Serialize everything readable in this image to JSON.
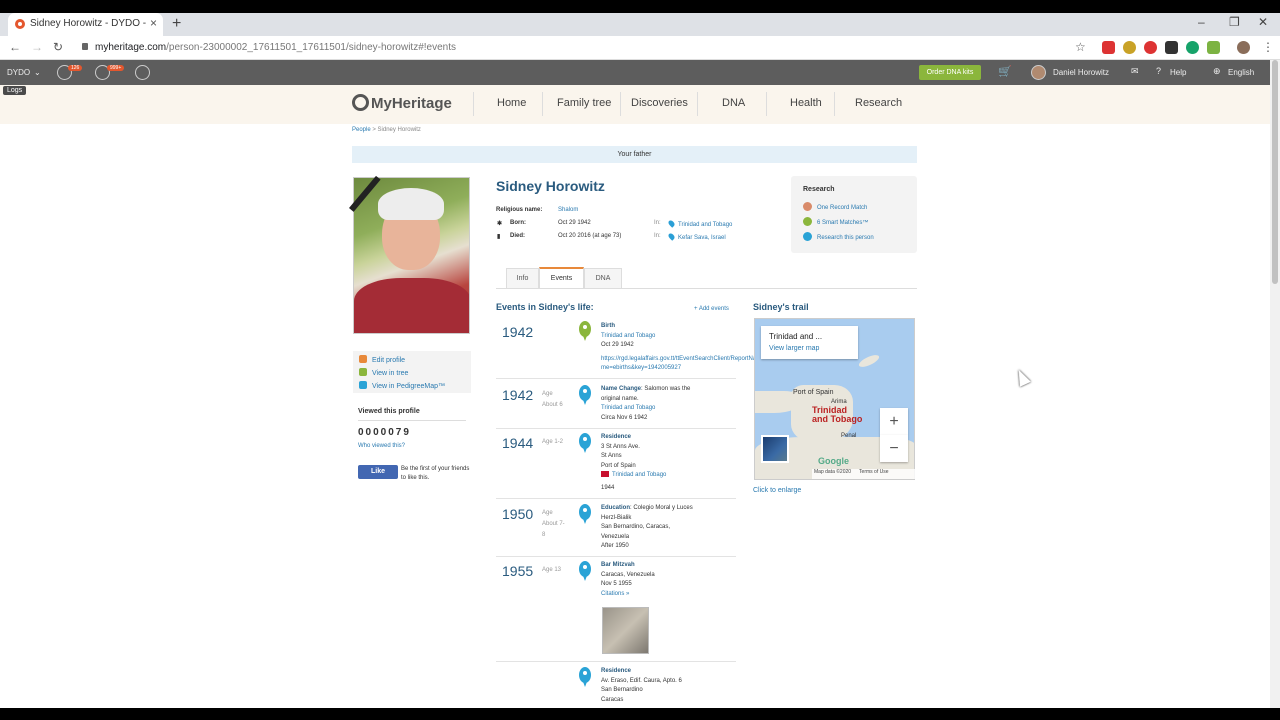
{
  "browser": {
    "tab_title": "Sidney Horowitz - DYDO - MyHeritage",
    "url_main": "myheritage.com",
    "url_rest": "/person-23000002_17611501_17611501/sidney-horowitz#!events"
  },
  "mhbar": {
    "site_name": "DYDO",
    "badge1": "126",
    "badge2": "999+",
    "order_label": "Order DNA kits",
    "user_name": "Daniel Horowitz",
    "help": "Help",
    "language": "English",
    "logs": "Logs"
  },
  "nav": {
    "logo": "MyHeritage",
    "items": [
      "Home",
      "Family tree",
      "Discoveries",
      "DNA",
      "Health",
      "Research"
    ]
  },
  "breadcrumb": {
    "people": "People",
    "sep": ">",
    "current": "Sidney Horowitz"
  },
  "relation": "Your father",
  "person": {
    "name": "Sidney Horowitz",
    "religious_label": "Religious name:",
    "religious_value": "Shalom",
    "born_label": "Born:",
    "born_date": "Oct 29 1942",
    "born_in": "In:",
    "born_place": "Trinidad and Tobago",
    "died_label": "Died:",
    "died_date": "Oct 20 2016 (at age 73)",
    "died_in": "In:",
    "died_place": "Kefar Sava, Israel"
  },
  "research": {
    "title": "Research",
    "items": [
      "One Record Match",
      "6 Smart Matches™",
      "Research this person"
    ]
  },
  "side": {
    "actions": [
      "Edit profile",
      "View in tree",
      "View in PedigreeMap™"
    ],
    "viewed_title": "Viewed this profile",
    "counter": "0000079",
    "who_viewed": "Who viewed this?",
    "like": "Like",
    "like_text": "Be the first of your friends to like this."
  },
  "tabs": [
    "Info",
    "Events",
    "DNA"
  ],
  "events_title": "Events in Sidney's life:",
  "add_events": "+ Add events",
  "events": [
    {
      "year": "1942",
      "age": "",
      "title": "Birth",
      "lines": [
        "Trinidad and Tobago",
        "Oct 29 1942"
      ],
      "link": "https://rgd.legalaffairs.gov.tt/ttEventSearchClient/ReportName=ebirths&key=1942005927"
    },
    {
      "year": "1942",
      "age": "Age",
      "age2": "About 6",
      "title": "Name Change",
      "desc": ": Salomon was the original name.",
      "lines": [
        "Trinidad and Tobago",
        "Circa Nov 6 1942"
      ]
    },
    {
      "year": "1944",
      "age": "Age 1-2",
      "title": "Residence",
      "lines": [
        "3 St Anns Ave.",
        "St Anns",
        "Port of Spain",
        "Trinidad and Tobago",
        "1944"
      ]
    },
    {
      "year": "1950",
      "age": "Age",
      "age2": "About 7-",
      "age3": "8",
      "title": "Education",
      "desc": ": Colegio Moral y Luces Herzl-Bialik",
      "lines": [
        "San Bernardino, Caracas, Venezuela",
        "After 1950"
      ]
    },
    {
      "year": "1955",
      "age": "Age 13",
      "title": "Bar Mitzvah",
      "lines": [
        "Caracas, Venezuela",
        "Nov 5 1955"
      ],
      "link": "Citations »"
    },
    {
      "year": "",
      "age": "",
      "title": "Residence",
      "lines": [
        "Av. Eraso, Edif. Caura, Apto. 6",
        "San Bernardino",
        "Caracas"
      ]
    }
  ],
  "trail": {
    "title": "Sidney's trail",
    "card_title": "Trinidad and ...",
    "card_link": "View larger map",
    "label_port": "Port of Spain",
    "label_arima": "Arima",
    "label_big1": "Trinidad",
    "label_big2": "and Tobago",
    "label_penal": "Penal",
    "zoom_in": "+",
    "zoom_out": "−",
    "google": "Google",
    "mapdata": "Map data ©2020",
    "terms": "Terms of Use",
    "enlarge": "Click to enlarge"
  }
}
